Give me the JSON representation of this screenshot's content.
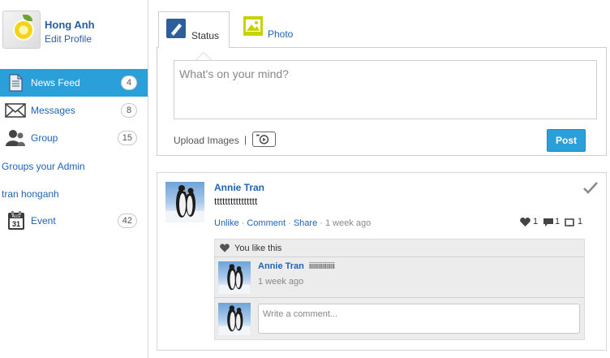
{
  "profile": {
    "name": "Hong Anh",
    "edit_label": "Edit Profile"
  },
  "nav": {
    "items": [
      {
        "label": "News Feed",
        "count": "4",
        "icon": "document-icon",
        "active": true
      },
      {
        "label": "Messages",
        "count": "8",
        "icon": "envelope-icon"
      },
      {
        "label": "Group",
        "count": "15",
        "icon": "group-icon"
      }
    ],
    "groups_admin": "Groups your Admin",
    "group_link": "tran honganh",
    "event": {
      "label": "Event",
      "count": "42",
      "icon": "calendar-icon",
      "calendar_month": "AUG",
      "calendar_day": "31"
    }
  },
  "composer": {
    "tabs": [
      {
        "label": "Status",
        "icon": "pencil-icon"
      },
      {
        "label": "Photo",
        "icon": "photo-icon"
      }
    ],
    "placeholder": "What's on your mind?",
    "upload_label": "Upload Images",
    "separator": "|",
    "post_label": "Post"
  },
  "feed": {
    "post": {
      "author": "Annie Tran",
      "text": "tttttttttttttttt",
      "actions": [
        "Unlike",
        "Comment",
        "Share"
      ],
      "time": "1 week ago",
      "stats": {
        "likes": "1",
        "comments": "1",
        "shares": "1"
      }
    },
    "likes_text": "You like this",
    "comment": {
      "author": "Annie Tran",
      "text": "iiiiiiiiiiiii",
      "time": "1 week ago"
    },
    "comment_placeholder": "Write a comment..."
  },
  "colors": {
    "accent": "#2b9fd9",
    "link": "#1f63b5",
    "photo_icon": "#c8d200"
  }
}
